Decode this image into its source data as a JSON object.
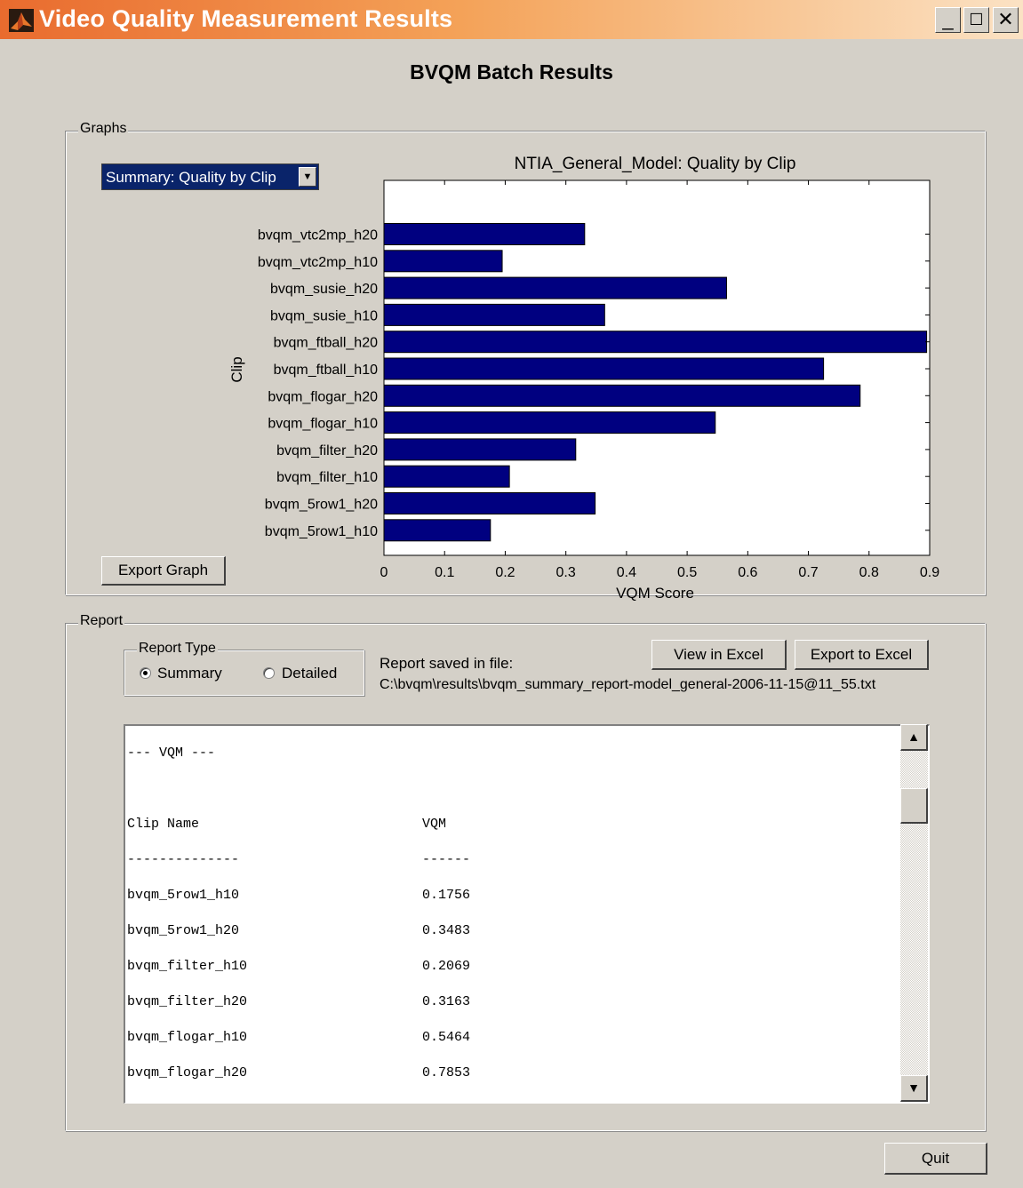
{
  "window": {
    "title": "Video Quality Measurement Results",
    "minimize_icon": "minimize-icon",
    "maximize_icon": "maximize-icon",
    "close_icon": "close-icon"
  },
  "main_title": "BVQM Batch Results",
  "graphs": {
    "group_label": "Graphs",
    "selector_value": "Summary: Quality by Clip",
    "export_button": "Export Graph"
  },
  "chart_data": {
    "type": "bar",
    "orientation": "horizontal",
    "title": "NTIA_General_Model: Quality by Clip",
    "xlabel": "VQM Score",
    "ylabel": "Clip",
    "xlim": [
      0,
      0.9
    ],
    "x_ticks": [
      "0",
      "0.1",
      "0.2",
      "0.3",
      "0.4",
      "0.5",
      "0.6",
      "0.7",
      "0.8",
      "0.9"
    ],
    "bar_color": "#000080",
    "categories": [
      "bvqm_vtc2mp_h20",
      "bvqm_vtc2mp_h10",
      "bvqm_susie_h20",
      "bvqm_susie_h10",
      "bvqm_ftball_h20",
      "bvqm_ftball_h10",
      "bvqm_flogar_h20",
      "bvqm_flogar_h10",
      "bvqm_filter_h20",
      "bvqm_filter_h10",
      "bvqm_5row1_h20",
      "bvqm_5row1_h10"
    ],
    "values": [
      0.331,
      0.195,
      0.565,
      0.364,
      0.895,
      0.725,
      0.7853,
      0.5464,
      0.3163,
      0.2069,
      0.3483,
      0.1756
    ]
  },
  "report": {
    "group_label": "Report",
    "type_label": "Report Type",
    "summary_label": "Summary",
    "detailed_label": "Detailed",
    "selected": "Summary",
    "saved_label": "Report saved in file:",
    "saved_path": "C:\\bvqm\\results\\bvqm_summary_report-model_general-2006-11-15@11_55.txt",
    "view_excel_button": "View in Excel",
    "export_excel_button": "Export to Excel",
    "text_lines": [
      {
        "name": "--- VQM ---",
        "value": ""
      },
      {
        "name": "",
        "value": ""
      },
      {
        "name": "Clip Name",
        "value": "VQM"
      },
      {
        "name": "--------------",
        "value": "------"
      },
      {
        "name": "bvqm_5row1_h10",
        "value": "0.1756"
      },
      {
        "name": "bvqm_5row1_h20",
        "value": "0.3483"
      },
      {
        "name": "bvqm_filter_h10",
        "value": "0.2069"
      },
      {
        "name": "bvqm_filter_h20",
        "value": "0.3163"
      },
      {
        "name": "bvqm_flogar_h10",
        "value": "0.5464"
      },
      {
        "name": "bvqm_flogar_h20",
        "value": "0.7853"
      }
    ]
  },
  "quit_button": "Quit"
}
